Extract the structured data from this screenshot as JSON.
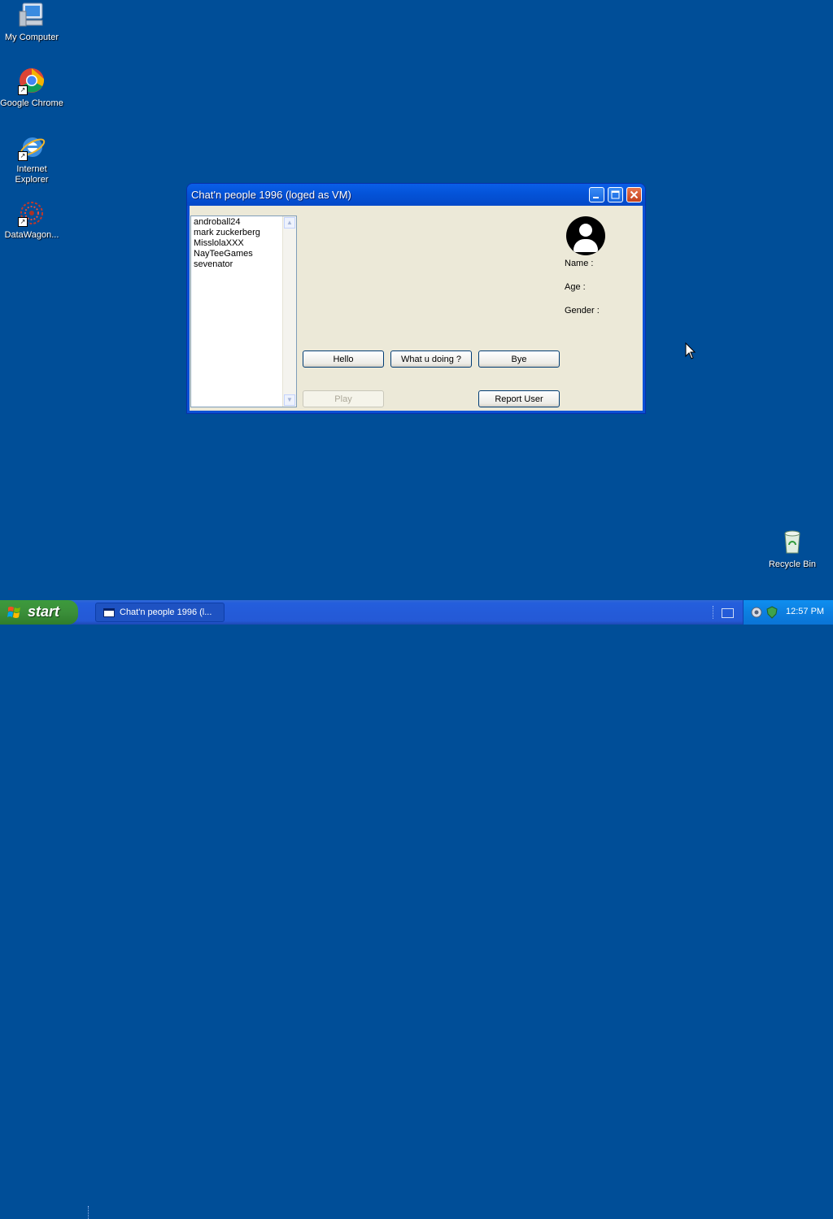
{
  "desktop": {
    "icons": [
      {
        "label": "My Computer",
        "icon": "my-computer-icon"
      },
      {
        "label": "Google Chrome",
        "icon": "chrome-icon"
      },
      {
        "label_line1": "Internet",
        "label_line2": "Explorer",
        "icon": "internet-explorer-icon"
      },
      {
        "label": "DataWagon...",
        "icon": "datawagon-icon"
      },
      {
        "label": "Recycle Bin",
        "icon": "recycle-bin-icon"
      }
    ]
  },
  "window": {
    "title": "Chat'n people 1996 (loged as VM)",
    "users": [
      "androball24",
      "mark zuckerberg",
      "MisslolaXXX",
      "NayTeeGames",
      "sevenator"
    ],
    "buttons": {
      "hello": "Hello",
      "what": "What u doing ?",
      "bye": "Bye",
      "play": "Play",
      "report": "Report User"
    },
    "profile": {
      "name_label": "Name :",
      "age_label": "Age :",
      "gender_label": "Gender :"
    }
  },
  "taskbar": {
    "start_label": "start",
    "task_label": "Chat'n people 1996 (l...",
    "clock": "12:57 PM"
  },
  "colors": {
    "desktop": "#004e98",
    "titlebar": "#0453d8",
    "client": "#ece9d8",
    "start": "#3b8f3a"
  }
}
